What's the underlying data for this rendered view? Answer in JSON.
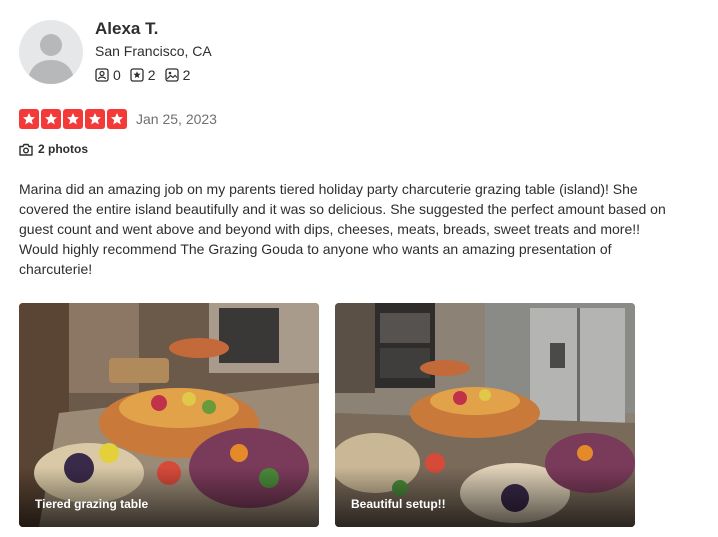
{
  "user": {
    "name": "Alexa T.",
    "location": "San Francisco, CA",
    "stats": {
      "friends": "0",
      "reviews": "2",
      "photos": "2"
    }
  },
  "review": {
    "rating_stars": 5,
    "date": "Jan 25, 2023",
    "photos_label": "2 photos",
    "text": "Marina did an amazing job on my parents tiered holiday party charcuterie grazing table (island)! She covered the entire island beautifully and it was so delicious. She suggested the perfect amount based on guest count and went above and beyond with dips, cheeses, meats, breads, sweet treats and more!! Would highly recommend The Grazing Gouda to anyone who wants an amazing presentation of charcuterie!"
  },
  "photos": [
    {
      "caption": "Tiered grazing table"
    },
    {
      "caption": "Beautiful setup!!"
    }
  ],
  "colors": {
    "star_red": "#f43939",
    "text": "#2d2e2f",
    "muted": "#6e7072",
    "avatar_bg": "#e6e7e9"
  }
}
